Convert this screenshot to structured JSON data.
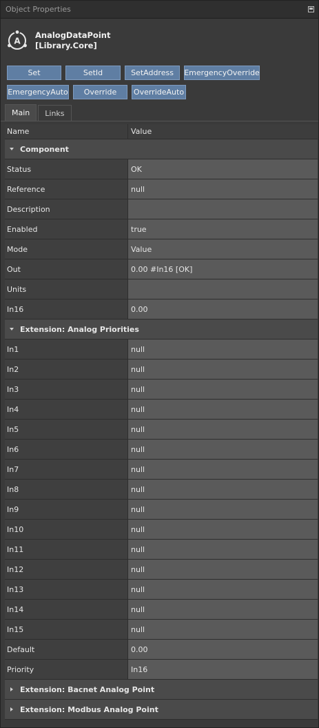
{
  "window": {
    "title": "Object Properties"
  },
  "object": {
    "name_line1": "AnalogDataPoint",
    "name_line2": "[Library.Core]",
    "icon": "analog-point-icon"
  },
  "buttons_row1": [
    "Set",
    "SetId",
    "SetAddress",
    "EmergencyOverride"
  ],
  "buttons_row2": [
    "EmergencyAuto",
    "Override",
    "OverrideAuto"
  ],
  "tabs": [
    {
      "label": "Main",
      "active": true
    },
    {
      "label": "Links",
      "active": false
    }
  ],
  "grid": {
    "columns": {
      "name": "Name",
      "value": "Value"
    },
    "groups": [
      {
        "label": "Component",
        "expanded": true,
        "rows": [
          {
            "name": "Status",
            "value": "OK"
          },
          {
            "name": "Reference",
            "value": "null"
          },
          {
            "name": "Description",
            "value": ""
          },
          {
            "name": "Enabled",
            "value": "true"
          },
          {
            "name": "Mode",
            "value": "Value"
          },
          {
            "name": "Out",
            "value": "0.00 #In16 [OK]"
          },
          {
            "name": "Units",
            "value": ""
          },
          {
            "name": "In16",
            "value": "0.00"
          }
        ]
      },
      {
        "label": "Extension: Analog Priorities",
        "expanded": true,
        "rows": [
          {
            "name": "In1",
            "value": "null"
          },
          {
            "name": "In2",
            "value": "null"
          },
          {
            "name": "In3",
            "value": "null"
          },
          {
            "name": "In4",
            "value": "null"
          },
          {
            "name": "In5",
            "value": "null"
          },
          {
            "name": "In6",
            "value": "null"
          },
          {
            "name": "In7",
            "value": "null"
          },
          {
            "name": "In8",
            "value": "null"
          },
          {
            "name": "In9",
            "value": "null"
          },
          {
            "name": "In10",
            "value": "null"
          },
          {
            "name": "In11",
            "value": "null"
          },
          {
            "name": "In12",
            "value": "null"
          },
          {
            "name": "In13",
            "value": "null"
          },
          {
            "name": "In14",
            "value": "null"
          },
          {
            "name": "In15",
            "value": "null"
          },
          {
            "name": "Default",
            "value": "0.00"
          },
          {
            "name": "Priority",
            "value": "In16"
          }
        ]
      },
      {
        "label": "Extension: Bacnet Analog Point",
        "expanded": false,
        "rows": []
      },
      {
        "label": "Extension: Modbus Analog Point",
        "expanded": false,
        "rows": []
      }
    ]
  }
}
